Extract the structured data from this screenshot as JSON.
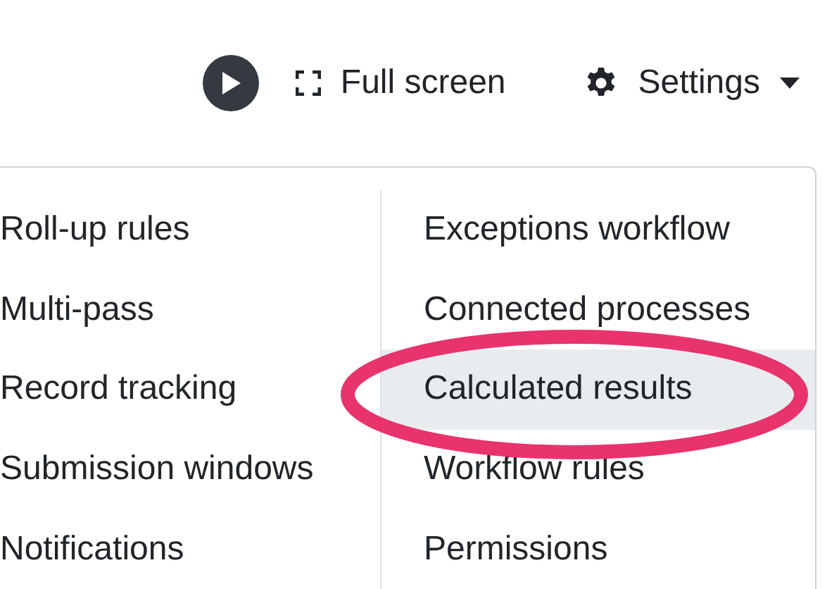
{
  "toolbar": {
    "play_button": {
      "kind": "play"
    },
    "fullscreen_button": {
      "label": "Full screen"
    },
    "settings_button": {
      "label": "Settings",
      "expanded": true
    }
  },
  "settings_menu": {
    "columns": [
      [
        {
          "label": "Roll-up rules",
          "selected": false
        },
        {
          "label": "Multi-pass",
          "selected": false
        },
        {
          "label": "Record tracking",
          "selected": false
        },
        {
          "label": "Submission windows",
          "selected": false
        },
        {
          "label": "Notifications",
          "selected": false
        }
      ],
      [
        {
          "label": "Exceptions workflow",
          "selected": false
        },
        {
          "label": "Connected processes",
          "selected": false
        },
        {
          "label": "Calculated results",
          "selected": true
        },
        {
          "label": "Workflow rules",
          "selected": false
        },
        {
          "label": "Permissions",
          "selected": false
        }
      ]
    ]
  }
}
